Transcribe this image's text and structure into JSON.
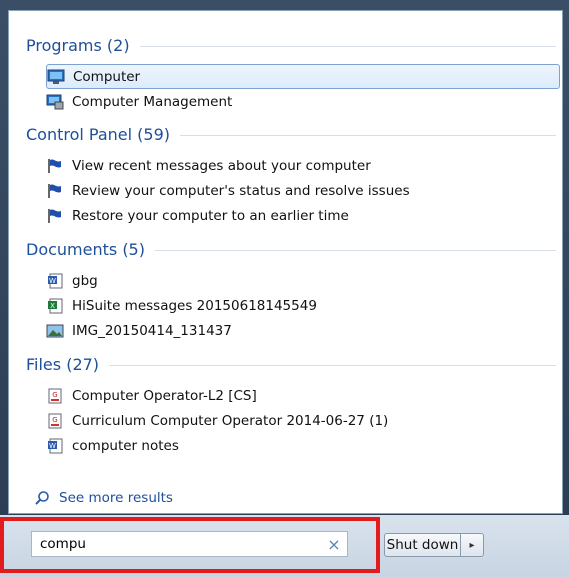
{
  "groups": [
    {
      "header": "Programs (2)",
      "items": [
        {
          "label": "Computer",
          "icon": "computer-icon",
          "selected": true
        },
        {
          "label": "Computer Management",
          "icon": "computer-management-icon",
          "selected": false
        }
      ]
    },
    {
      "header": "Control Panel (59)",
      "items": [
        {
          "label": "View recent messages about your computer",
          "icon": "flag-icon"
        },
        {
          "label": "Review your computer's status and resolve issues",
          "icon": "flag-icon"
        },
        {
          "label": "Restore your computer to an earlier time",
          "icon": "flag-icon"
        }
      ]
    },
    {
      "header": "Documents (5)",
      "items": [
        {
          "label": "gbg",
          "icon": "word-doc-icon"
        },
        {
          "label": "HiSuite messages 20150618145549",
          "icon": "excel-doc-icon"
        },
        {
          "label": "IMG_20150414_131437",
          "icon": "image-file-icon"
        }
      ]
    },
    {
      "header": "Files (27)",
      "items": [
        {
          "label": "Computer Operator-L2 [CS]",
          "icon": "pdf-file-icon"
        },
        {
          "label": "Curriculum Computer Operator 2014-06-27 (1)",
          "icon": "pdf-file-icon"
        },
        {
          "label": "computer notes",
          "icon": "word-doc-icon"
        }
      ]
    }
  ],
  "see_more": "See more results",
  "search": {
    "value": "compu",
    "clear_glyph": "×"
  },
  "shutdown": {
    "label": "Shut down",
    "arrow": "▸"
  },
  "colors": {
    "header": "#1e4f9a",
    "highlight": "#e21c1c",
    "selection_border": "#7da2ce"
  }
}
